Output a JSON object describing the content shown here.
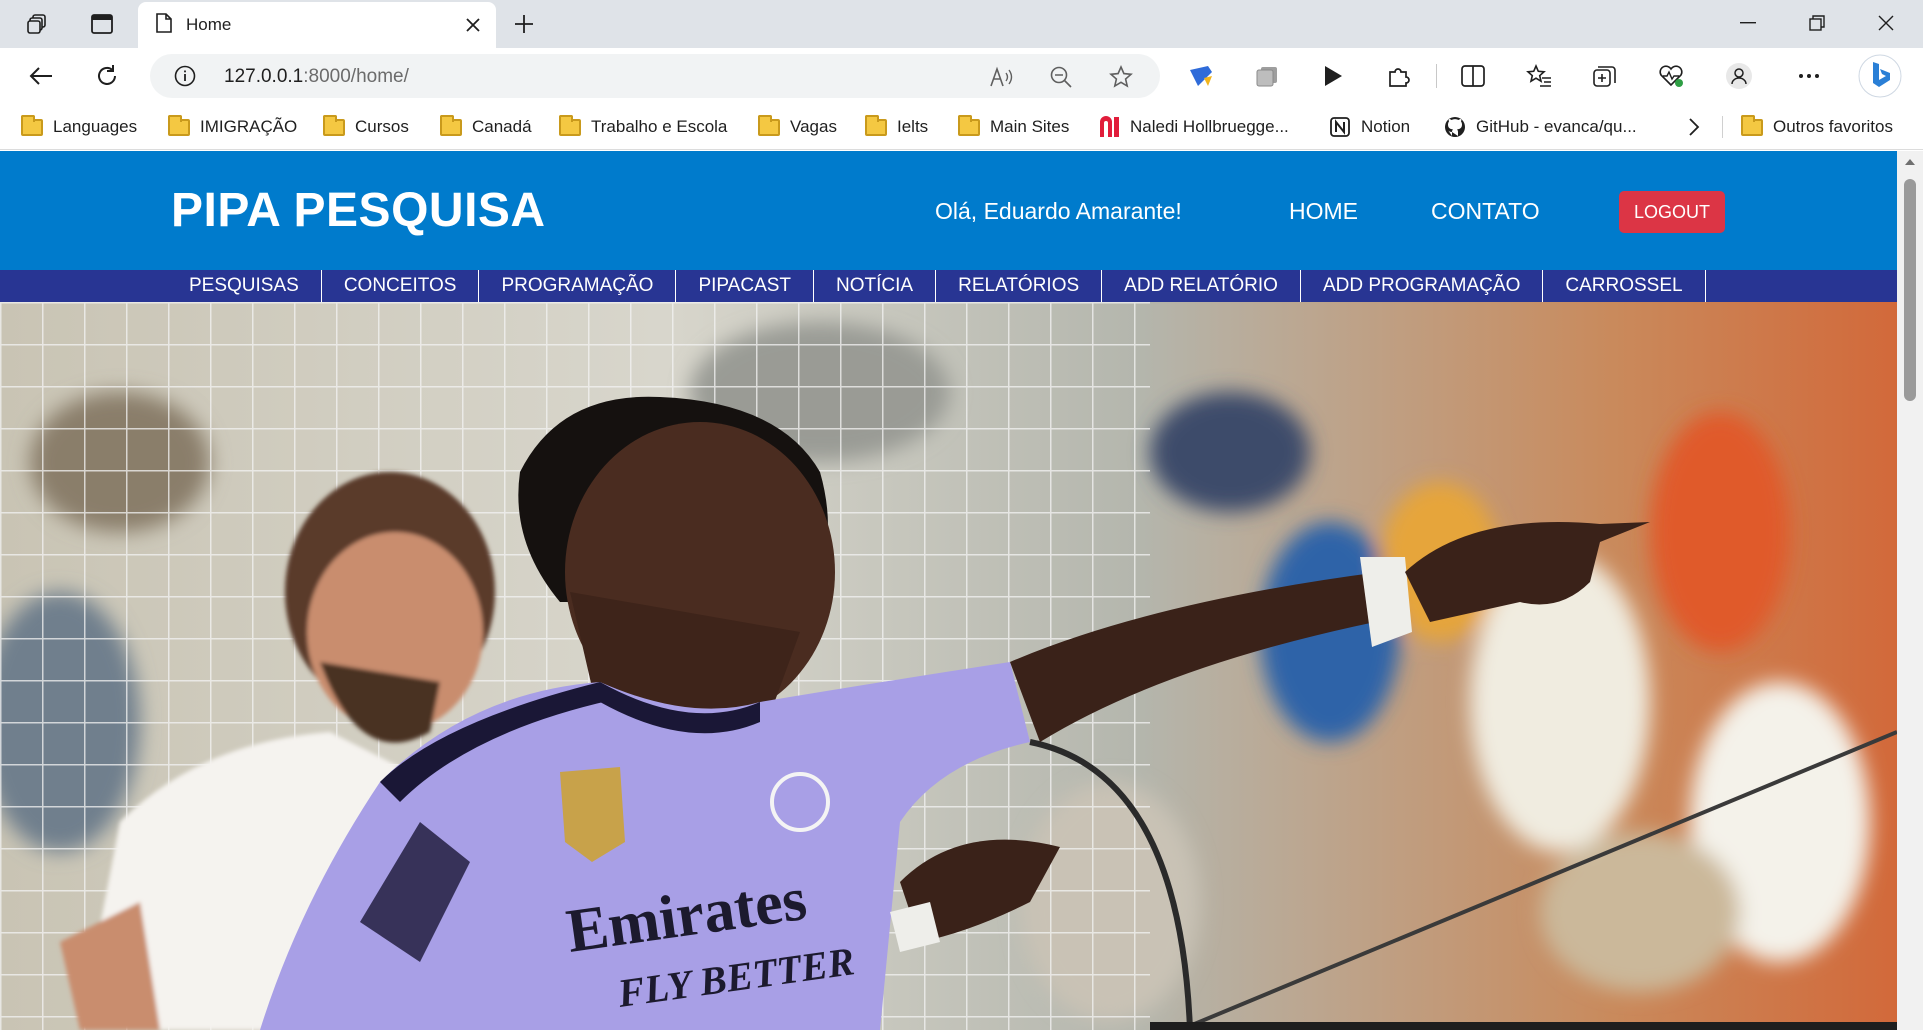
{
  "browser": {
    "tab_title": "Home",
    "url_host": "127.0.0.1",
    "url_rest": ":8000/home/",
    "bookmarks": [
      {
        "label": "Languages",
        "icon": "folder-icon"
      },
      {
        "label": "IMIGRAÇÃO",
        "icon": "folder-icon"
      },
      {
        "label": "Cursos",
        "icon": "folder-icon"
      },
      {
        "label": "Canadá",
        "icon": "folder-icon"
      },
      {
        "label": "Trabalho e Escola",
        "icon": "folder-icon"
      },
      {
        "label": "Vagas",
        "icon": "folder-icon"
      },
      {
        "label": "Ielts",
        "icon": "folder-icon"
      },
      {
        "label": "Main Sites",
        "icon": "folder-icon"
      },
      {
        "label": "Naledi Hollbruegge...",
        "icon": "naledi-logo-icon"
      },
      {
        "label": "Notion",
        "icon": "notion-logo-icon"
      },
      {
        "label": "GitHub - evanca/qu...",
        "icon": "github-logo-icon"
      }
    ],
    "other_favorites": "Outros favoritos"
  },
  "site": {
    "brand": "PIPA PESQUISA",
    "greeting": "Olá, Eduardo Amarante!",
    "nav_home": "HOME",
    "nav_contato": "CONTATO",
    "logout": "LOGOUT",
    "subnav": [
      "PESQUISAS",
      "CONCEITOS",
      "PROGRAMAÇÃO",
      "PIPACAST",
      "NOTÍCIA",
      "RELATÓRIOS",
      "ADD RELATÓRIO",
      "ADD PROGRAMAÇÃO",
      "CARROSSEL"
    ],
    "hero_jersey_text_1": "Emirates",
    "hero_jersey_text_2": "FLY BETTER"
  },
  "colors": {
    "header_blue": "#007bcc",
    "subnav_indigo": "#283593",
    "logout_red": "#dc3545"
  }
}
